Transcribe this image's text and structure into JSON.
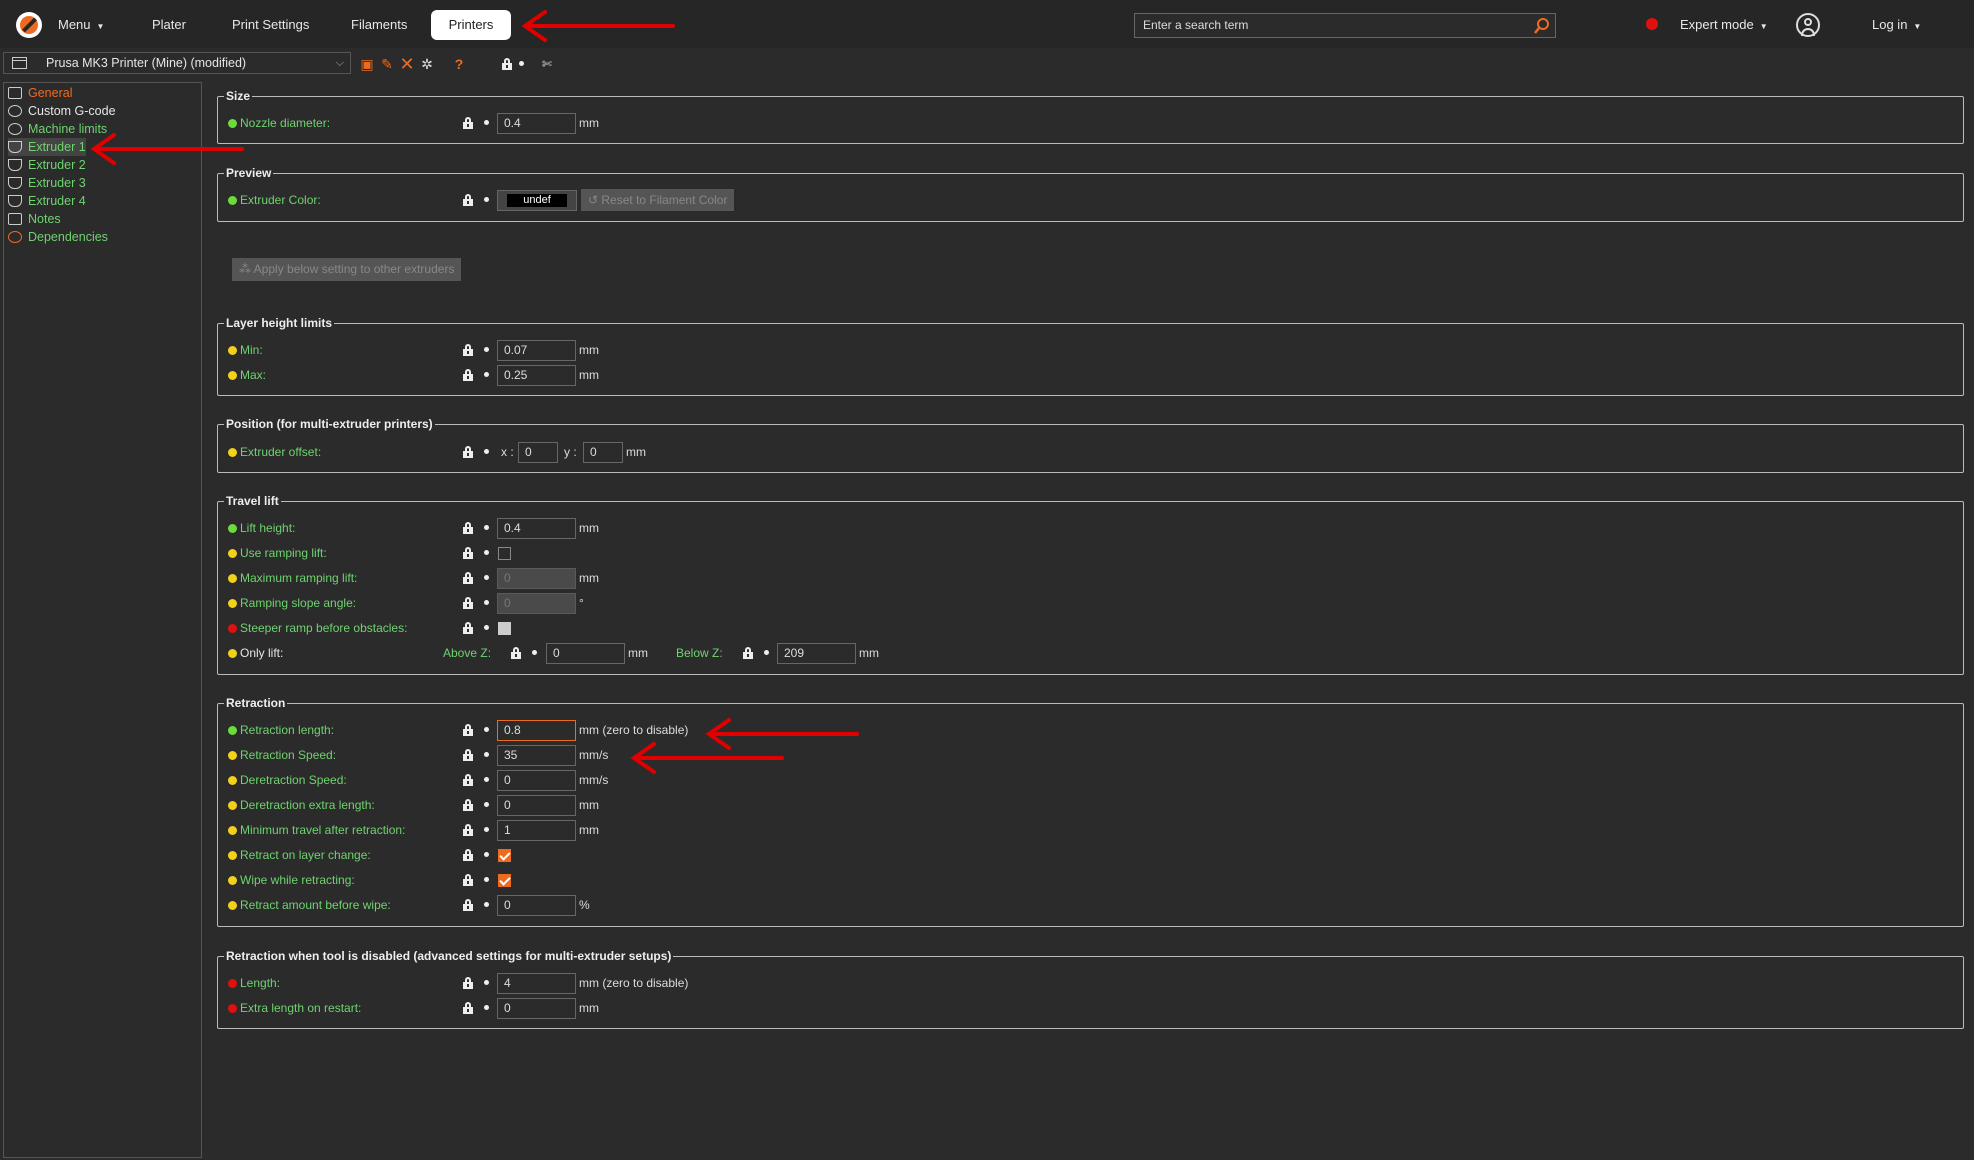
{
  "topbar": {
    "menu_label": "Menu",
    "tabs": [
      "Plater",
      "Print Settings",
      "Filaments",
      "Printers"
    ],
    "active_tab": "Printers",
    "search_placeholder": "Enter a search term",
    "mode_label": "Expert mode",
    "login_label": "Log in"
  },
  "preset": {
    "selected": "Prusa MK3 Printer (Mine) (modified)"
  },
  "sidebar": {
    "items": [
      {
        "label": "General",
        "icon": "printer-icon"
      },
      {
        "label": "Custom G-code",
        "icon": "cog-icon"
      },
      {
        "label": "Machine limits",
        "icon": "cog-icon"
      },
      {
        "label": "Extruder 1",
        "icon": "extruder-icon"
      },
      {
        "label": "Extruder 2",
        "icon": "extruder-icon"
      },
      {
        "label": "Extruder 3",
        "icon": "extruder-icon"
      },
      {
        "label": "Extruder 4",
        "icon": "extruder-icon"
      },
      {
        "label": "Notes",
        "icon": "notes-icon"
      },
      {
        "label": "Dependencies",
        "icon": "dependencies-icon"
      }
    ],
    "selected": "Extruder 1"
  },
  "groups": {
    "size": {
      "title": "Size",
      "nozzle_label": "Nozzle diameter:",
      "nozzle_value": "0.4",
      "unit": "mm"
    },
    "preview": {
      "title": "Preview",
      "color_label": "Extruder Color:",
      "color_value": "undef",
      "reset_button": "Reset to Filament Color"
    },
    "apply_button": "Apply below setting to other extruders",
    "layer": {
      "title": "Layer height limits",
      "min_label": "Min:",
      "min_value": "0.07",
      "max_label": "Max:",
      "max_value": "0.25",
      "unit": "mm"
    },
    "position": {
      "title": "Position (for multi-extruder printers)",
      "offset_label": "Extruder offset:",
      "x_label": "x :",
      "x_value": "0",
      "y_label": "y :",
      "y_value": "0",
      "unit": "mm"
    },
    "travel": {
      "title": "Travel lift",
      "lift_height_label": "Lift height:",
      "lift_height_value": "0.4",
      "ramping_label": "Use ramping lift:",
      "max_ramping_label": "Maximum ramping lift:",
      "max_ramping_value": "0",
      "slope_label": "Ramping slope angle:",
      "slope_value": "0",
      "slope_unit": "°",
      "steeper_label": "Steeper ramp before obstacles:",
      "only_lift_label": "Only lift:",
      "above_label": "Above Z:",
      "above_value": "0",
      "below_label": "Below Z:",
      "below_value": "209",
      "unit": "mm"
    },
    "retraction": {
      "title": "Retraction",
      "length_label": "Retraction length:",
      "length_value": "0.8",
      "length_unit": "mm (zero to disable)",
      "speed_label": "Retraction Speed:",
      "speed_value": "35",
      "speed_unit": "mm/s",
      "deretraction_label": "Deretraction Speed:",
      "deretraction_value": "0",
      "deretraction_unit": "mm/s",
      "extra_label": "Deretraction extra length:",
      "extra_value": "0",
      "extra_unit": "mm",
      "min_travel_label": "Minimum travel after retraction:",
      "min_travel_value": "1",
      "min_travel_unit": "mm",
      "layer_change_label": "Retract on layer change:",
      "wipe_label": "Wipe while retracting:",
      "before_wipe_label": "Retract amount before wipe:",
      "before_wipe_value": "0",
      "before_wipe_unit": "%"
    },
    "disabled": {
      "title": "Retraction when tool is disabled (advanced settings for multi-extruder setups)",
      "length_label": "Length:",
      "length_value": "4",
      "length_unit": "mm (zero to disable)",
      "restart_label": "Extra length on restart:",
      "restart_value": "0",
      "restart_unit": "mm"
    }
  },
  "colors": {
    "accent": "#ed6b21",
    "label_green": "#6fd36f",
    "annotation_red": "#e00000"
  }
}
